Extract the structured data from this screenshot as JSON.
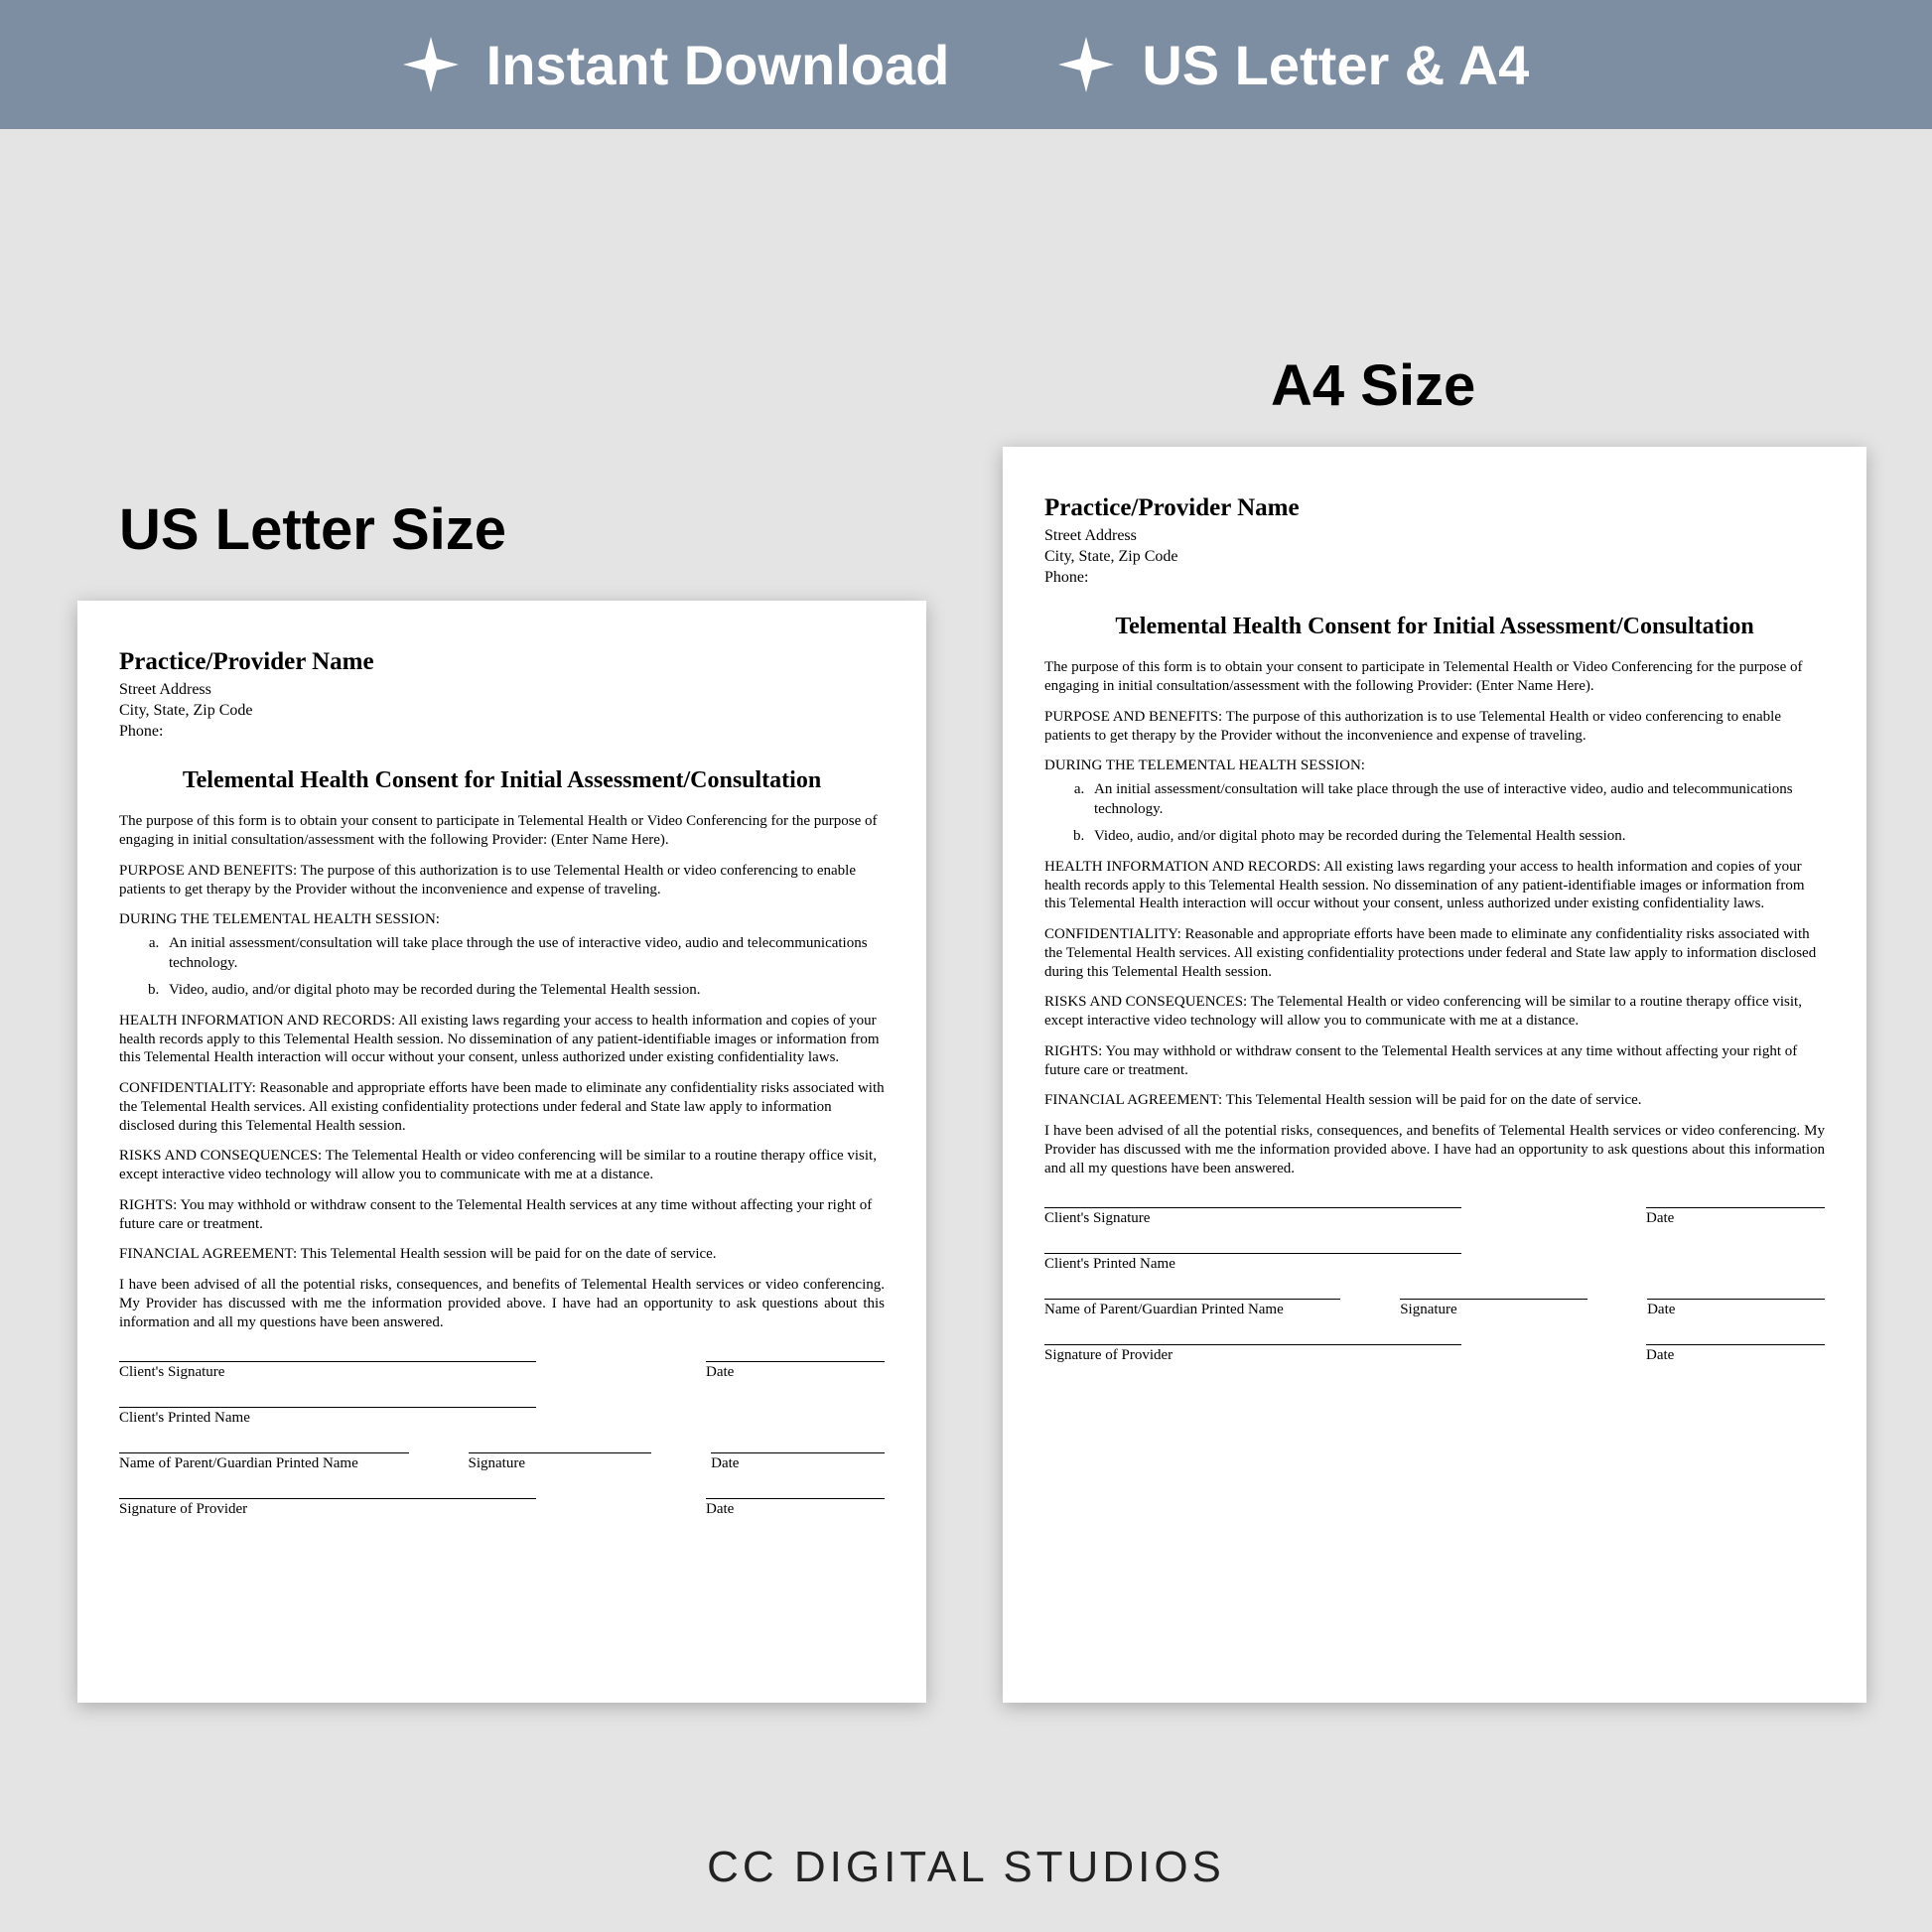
{
  "banner": {
    "item1": "Instant Download",
    "item2": "US Letter & A4"
  },
  "labels": {
    "usletter": "US Letter Size",
    "a4": "A4 Size"
  },
  "doc": {
    "provider_name": "Practice/Provider Name",
    "addr1": "Street Address",
    "addr2": "City, State, Zip Code",
    "addr3": "Phone:",
    "title": "Telemental Health Consent for Initial Assessment/Consultation",
    "intro": "The purpose of this form is to obtain your consent to participate in Telemental Health or Video Conferencing for the purpose of engaging in initial consultation/assessment with the following Provider: (Enter Name Here).",
    "purpose_label": "PURPOSE AND BENEFITS:",
    "purpose_body": "  The purpose of this authorization is to use Telemental Health or video conferencing to enable patients to get therapy by the Provider without the inconvenience and expense of traveling.",
    "during_label": "DURING THE TELEMENTAL HEALTH SESSION:",
    "during_a": "An initial assessment/consultation will take place through the use of interactive video, audio and telecommunications technology.",
    "during_b": "Video, audio, and/or digital photo may be recorded during the Telemental Health session.",
    "health_label": "HEALTH INFORMATION AND RECORDS:",
    "health_body": "  All existing laws regarding your access to health information and copies of your health records apply to this Telemental Health session.  No dissemination of any patient-identifiable images or information from this Telemental Health interaction will occur without your consent, unless authorized under existing confidentiality laws.",
    "conf_label": "CONFIDENTIALITY:",
    "conf_body": "  Reasonable and appropriate efforts have been made to eliminate any confidentiality risks associated with the Telemental Health services. All existing confidentiality protections under federal and State law apply to information disclosed during this Telemental Health session.",
    "risks_label": "RISKS AND CONSEQUENCES:",
    "risks_body": " The Telemental Health or video conferencing will be similar to a routine therapy office visit, except interactive video technology will allow you to communicate with me at a distance.",
    "rights_label": "RIGHTS:",
    "rights_body": "  You may withhold or withdraw consent to the Telemental Health services at any time without affecting your right of future care or treatment.",
    "fin_label": "FINANCIAL AGREEMENT:",
    "fin_body": "  This Telemental Health session will be paid for on the date of service.",
    "advised": "I have been advised of all the potential risks, consequences, and benefits of Telemental Health services or video conferencing.  My Provider has discussed with me the information provided above.  I have had an opportunity to ask questions about this information and all my questions have been answered.",
    "sig_client": "Client's Signature",
    "sig_date": "Date",
    "sig_printed": "Client's Printed Name",
    "sig_guardian": "Name of Parent/Guardian Printed Name",
    "sig_signature": "Signature",
    "sig_provider": "Signature of Provider"
  },
  "footer": "CC DIGITAL STUDIOS"
}
